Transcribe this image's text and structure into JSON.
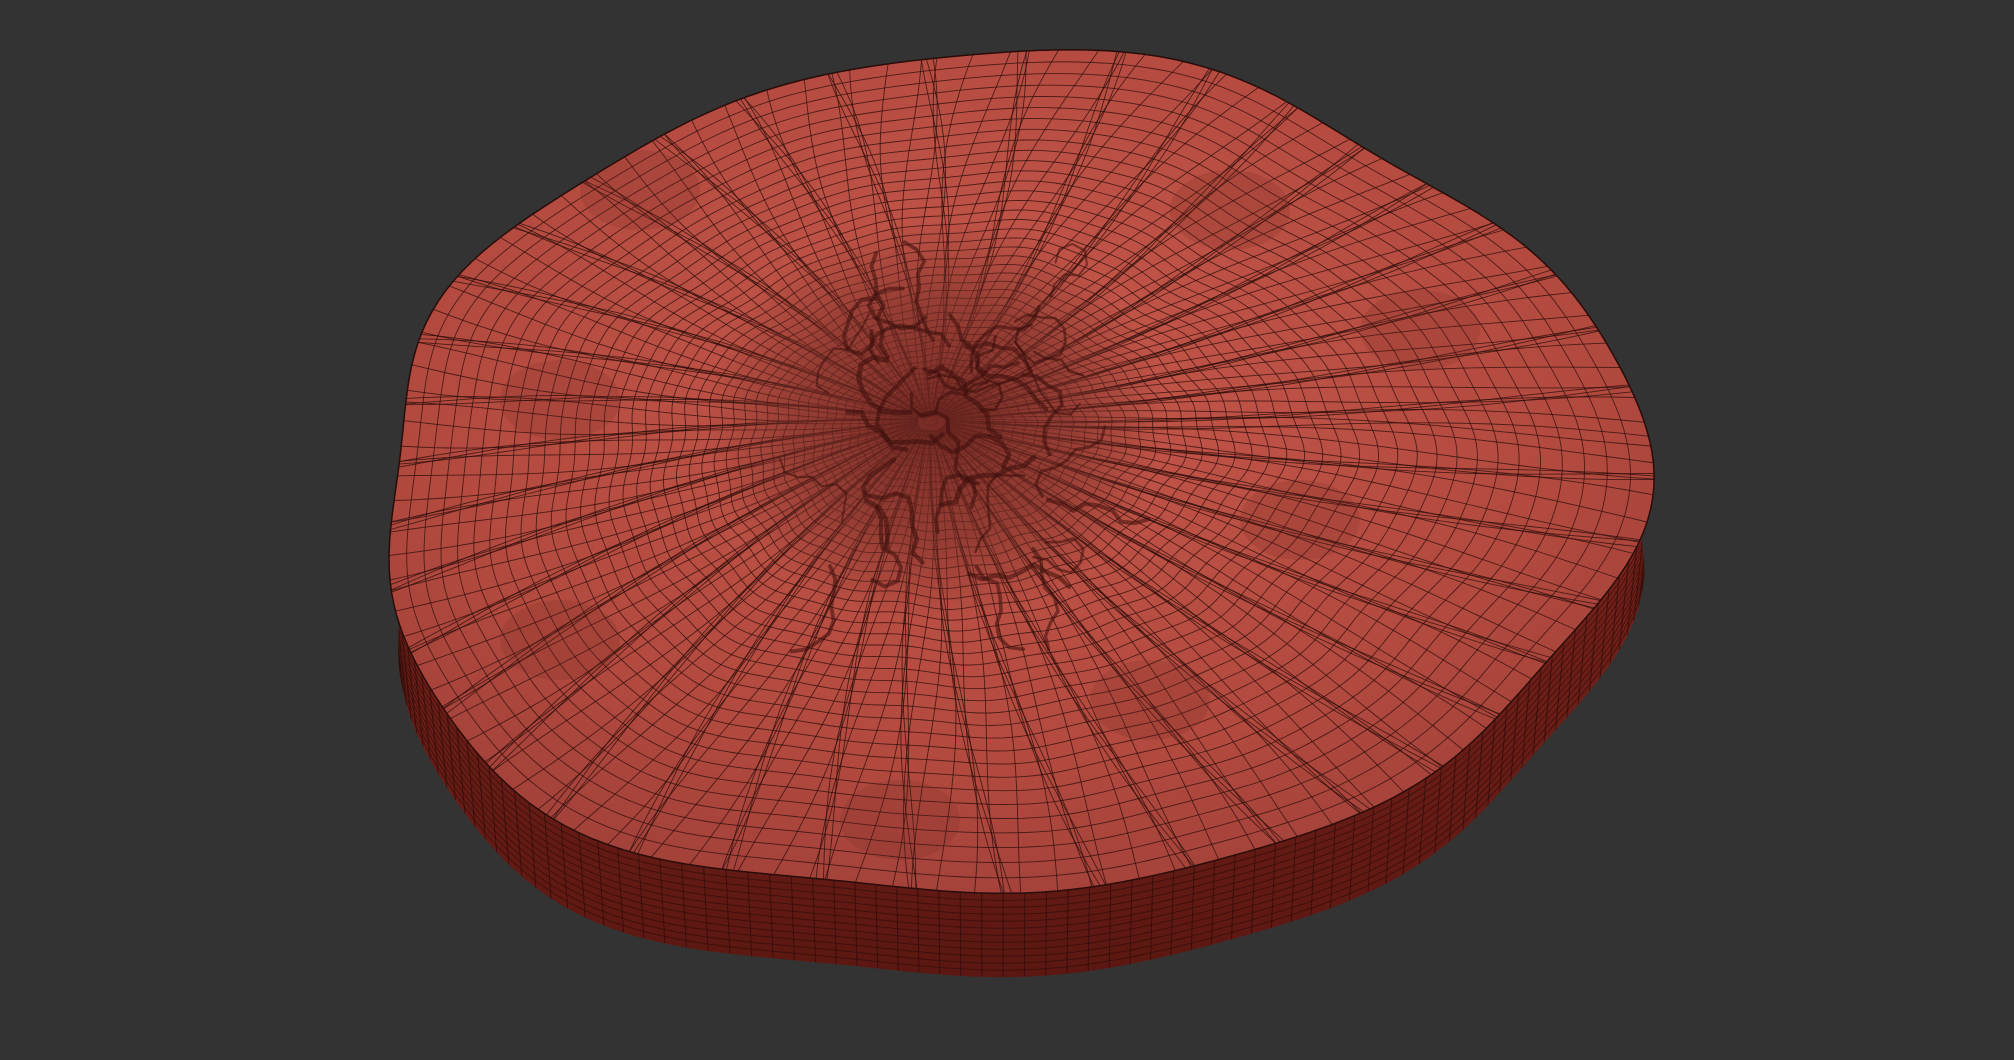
{
  "viewport": {
    "background_color": "#333333"
  },
  "mesh": {
    "description_name": "sculpted-disc",
    "top_color": "#b34a3f",
    "top_highlight_color": "#c5574a",
    "side_color": "#8e2b22",
    "side_shadow_color": "#5c1712",
    "wire_color": "#2a0c09",
    "crater_color": "#7a2f28"
  }
}
